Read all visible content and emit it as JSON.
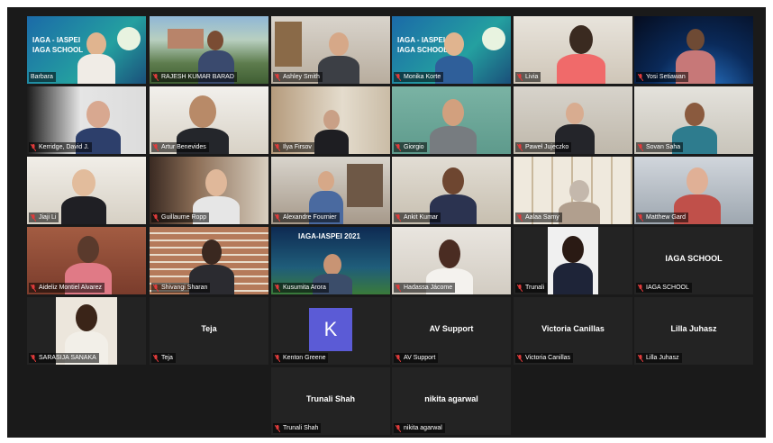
{
  "participants": [
    {
      "name": "Barbara",
      "type": "video"
    },
    {
      "name": "RAJESH KUMAR BARAD",
      "type": "video"
    },
    {
      "name": "Ashley Smith",
      "type": "video"
    },
    {
      "name": "Monika Korte",
      "type": "video"
    },
    {
      "name": "Livia",
      "type": "video"
    },
    {
      "name": "Yosi Setiawan",
      "type": "video"
    },
    {
      "name": "Kerridge, David J.",
      "type": "video"
    },
    {
      "name": "Artur Benevides",
      "type": "video"
    },
    {
      "name": "Ilya Firsov",
      "type": "video"
    },
    {
      "name": "Giorgio",
      "type": "video"
    },
    {
      "name": "Paweł Jujeczko",
      "type": "video"
    },
    {
      "name": "Sovan Saha",
      "type": "video"
    },
    {
      "name": "Jiaji Li",
      "type": "video"
    },
    {
      "name": "Guillaume Ropp",
      "type": "video"
    },
    {
      "name": "Alexandre Fournier",
      "type": "video"
    },
    {
      "name": "Ankit Kumar",
      "type": "video"
    },
    {
      "name": "Aalaa Samy",
      "type": "video"
    },
    {
      "name": "Matthew Gard",
      "type": "video"
    },
    {
      "name": "Aideliz Montiel Alvarez",
      "type": "video"
    },
    {
      "name": "Shivangi Sharan",
      "type": "video"
    },
    {
      "name": "Kusumita Arora",
      "type": "video"
    },
    {
      "name": "Hadassa Jácome",
      "type": "video"
    },
    {
      "name": "Trunali",
      "type": "video"
    },
    {
      "name": "IAGA SCHOOL",
      "type": "name",
      "display": "IAGA SCHOOL"
    },
    {
      "name": "SARASIJA SANAKA",
      "type": "video"
    },
    {
      "name": "Teja",
      "type": "name",
      "display": "Teja"
    },
    {
      "name": "Kenton Greene",
      "type": "avatar",
      "display": "K"
    },
    {
      "name": "AV Support",
      "type": "name",
      "display": "AV Support"
    },
    {
      "name": "Victoria Canillas",
      "type": "name",
      "display": "Victoria Canillas"
    },
    {
      "name": "Lilla Juhasz",
      "type": "name",
      "display": "Lilla Juhasz"
    },
    {
      "name": "Trunali Shah",
      "type": "name",
      "display": "Trunali Shah"
    },
    {
      "name": "nikita agarwal",
      "type": "name",
      "display": "nikita agarwal"
    }
  ],
  "banner": {
    "line1": "IAGA - IASPEI",
    "line2": "IAGA SCHOOL",
    "poster": "IAGA-IASPEI 2021"
  },
  "colors": {
    "active_border": "#d8c943",
    "avatar": "#5b5bd6",
    "muted_icon": "#e03b3b",
    "stage": "#1a1a1a",
    "tile": "#232323"
  }
}
